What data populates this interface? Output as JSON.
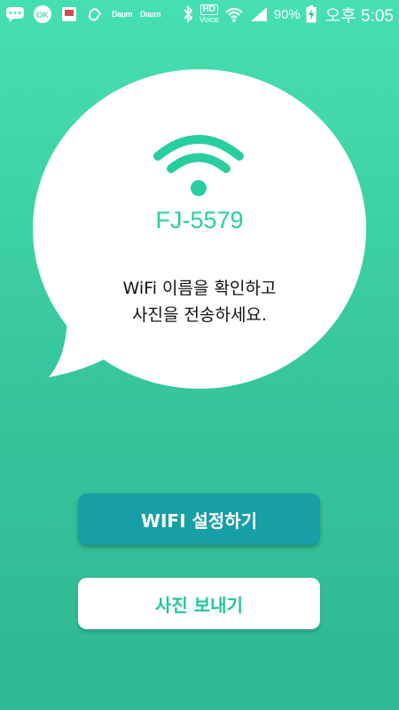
{
  "status_bar": {
    "daum_1": "Daum",
    "daum_2": "Daum",
    "hd": "HD",
    "voice": "Voice",
    "battery_percent": "90%",
    "time": "오후 5:05",
    "icons": [
      "chat-icon",
      "ok-cashbag-icon",
      "photo-icon",
      "hand-icon",
      "daum-icon",
      "daum-icon",
      "bluetooth-icon",
      "hd-voice-icon",
      "wifi-icon",
      "signal-icon",
      "battery-icon"
    ]
  },
  "bubble": {
    "ssid": "FJ-5579",
    "instruction_line1": "WiFi 이름을 확인하고",
    "instruction_line2": "사진을 전송하세요."
  },
  "buttons": {
    "wifi_settings": "WIFI 설정하기",
    "send_photo": "사진 보내기"
  },
  "colors": {
    "background": "#3fd3a7",
    "accent_green": "#27cfa0",
    "wifi_button": "#169fa6",
    "white": "#ffffff"
  }
}
